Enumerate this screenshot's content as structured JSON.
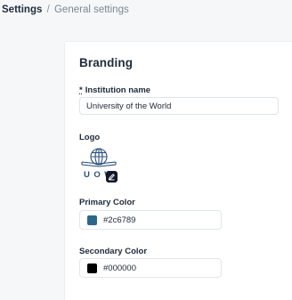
{
  "breadcrumb": {
    "root": "Settings",
    "separator": "/",
    "current": "General settings"
  },
  "branding": {
    "title": "Branding",
    "institution_name": {
      "required_mark": "*",
      "label": "Institution name",
      "value": "University of the World"
    },
    "logo": {
      "label": "Logo",
      "logo_text": "UOW",
      "icon": "globe-book-icon",
      "edit_icon": "pencil-icon"
    },
    "primary_color": {
      "label": "Primary Color",
      "value": "#2c6789",
      "swatch": "#2c6789"
    },
    "secondary_color": {
      "label": "Secondary Color",
      "value": "#000000",
      "swatch": "#000000"
    }
  },
  "colors": {
    "page_background": "#f6f7f9",
    "card_background": "#ffffff",
    "logo_blue": "#28507a"
  }
}
